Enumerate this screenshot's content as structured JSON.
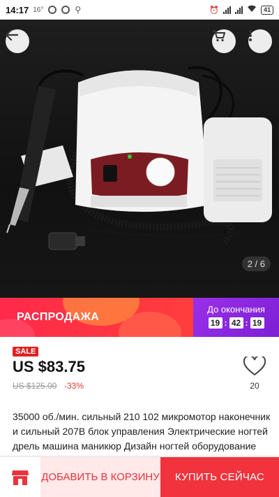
{
  "status_bar": {
    "time": "14:17",
    "temperature": "16°",
    "battery": "41"
  },
  "gallery": {
    "page_indicator": "2 / 6"
  },
  "sale_banner": {
    "title": "РАСПРОДАЖА",
    "countdown_label": "До окончания",
    "countdown": {
      "hours": "19",
      "minutes": "42",
      "seconds": "19"
    }
  },
  "product": {
    "badge": "SALE",
    "price": "US $83.75",
    "old_price": "US $125.00",
    "discount": "-33%",
    "wishlist_count": "20",
    "description": "35000 об./мин. сильный 210 102 микромотор наконечник и сильный 207B блок управления Электрические ногтей дрель машина маникюр Дизайн ногтей оборудование"
  },
  "actions": {
    "add_to_cart": "ДОБАВИТЬ В КОРЗИНУ",
    "buy_now": "КУПИТЬ СЕЙЧАС"
  },
  "colors": {
    "accent": "#f0333c",
    "banner_purple": "#8a2be2",
    "sale_red": "#e02020"
  },
  "icons": [
    "back-arrow-icon",
    "cart-icon",
    "more-vertical-icon",
    "heart-icon",
    "store-icon"
  ]
}
